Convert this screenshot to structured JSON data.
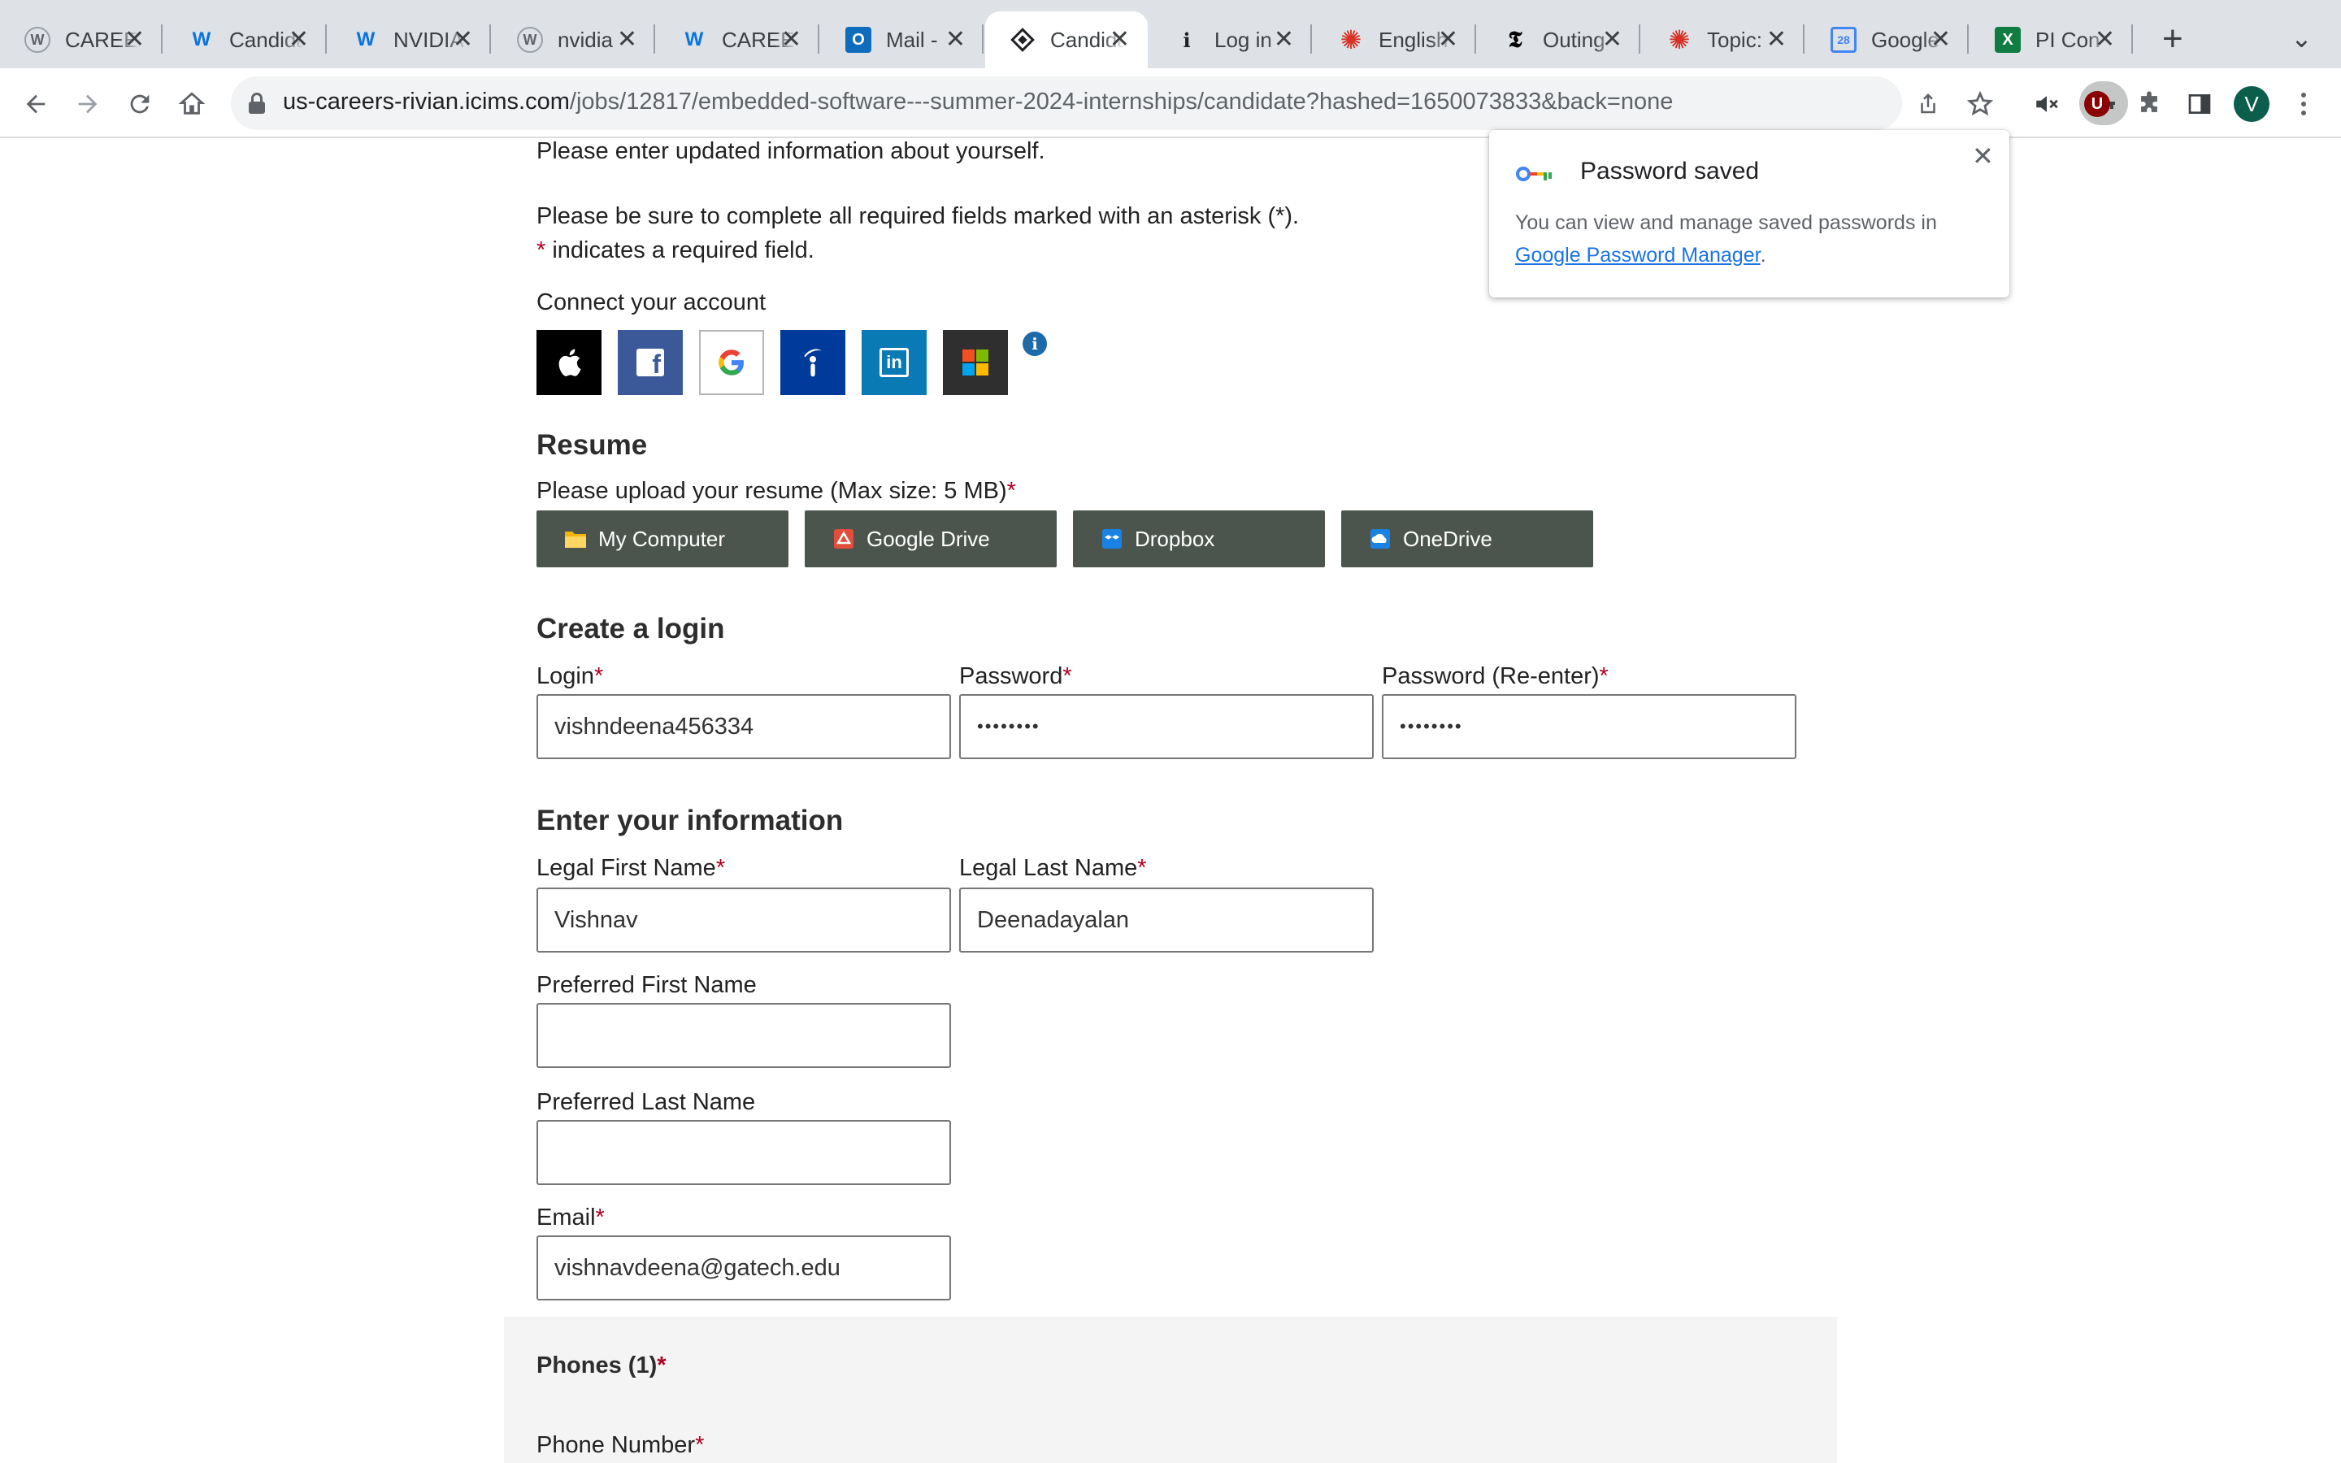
{
  "browser": {
    "tabs": [
      {
        "title": "CAREERS",
        "icon": "w-circle-icon"
      },
      {
        "title": "Candidate",
        "icon": "workday-icon"
      },
      {
        "title": "NVIDIA",
        "icon": "workday-icon"
      },
      {
        "title": "nvidia",
        "icon": "w-circle-icon"
      },
      {
        "title": "CAREERS",
        "icon": "workday-icon"
      },
      {
        "title": "Mail - ",
        "icon": "outlook-icon"
      },
      {
        "title": "Candidate",
        "icon": "icims-icon",
        "active": true
      },
      {
        "title": "Log in",
        "icon": "info-icon"
      },
      {
        "title": "English",
        "icon": "gear-red-icon"
      },
      {
        "title": "Outing",
        "icon": "nyt-icon"
      },
      {
        "title": "Topic:",
        "icon": "gear-red-icon"
      },
      {
        "title": "Google",
        "icon": "calendar-icon",
        "badge": "28"
      },
      {
        "title": "PI Con",
        "icon": "excel-icon"
      }
    ],
    "url_host": "us-careers-rivian.icims.com",
    "url_path": "/jobs/12817/embedded-software---summer-2024-internships/candidate?hashed=1650073833&back=none",
    "profile_initial": "V",
    "extension_badge": "U"
  },
  "page": {
    "intro": "Please enter updated information about yourself.",
    "required_note": "Please be sure to complete all required fields marked with an asterisk (*).",
    "asterisk": "*",
    "required_legend": " indicates a required field.",
    "connect_label": "Connect your account",
    "resume_heading": "Resume",
    "resume_prompt": "Please upload your resume (Max size: 5 MB)",
    "upload_buttons": [
      "My Computer",
      "Google Drive",
      "Dropbox",
      "OneDrive"
    ],
    "login_heading": "Create a login",
    "login_label": "Login",
    "login_value": "vishndeena456334",
    "password_label": "Password",
    "password_value": "••••••••",
    "password_re_label": "Password (Re-enter)",
    "password_re_value": "••••••••",
    "info_heading": "Enter your information",
    "first_name_label": "Legal First Name",
    "first_name_value": "Vishnav",
    "last_name_label": "Legal Last Name",
    "last_name_value": "Deenadayalan",
    "pref_first_label": "Preferred First Name",
    "pref_first_value": "",
    "pref_last_label": "Preferred Last Name",
    "pref_last_value": "",
    "email_label": "Email",
    "email_value": "vishnavdeena@gatech.edu",
    "phones_heading": "Phones (1)",
    "phone_number_label": "Phone Number"
  },
  "popup": {
    "title": "Password saved",
    "body": "You can view and manage saved passwords in",
    "link": "Google Password Manager",
    "period": "."
  }
}
